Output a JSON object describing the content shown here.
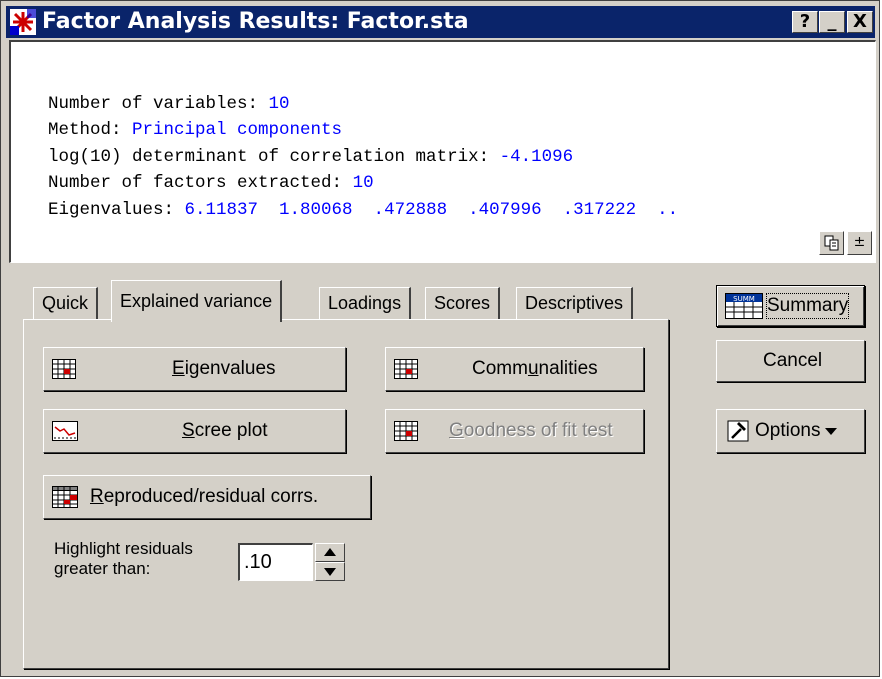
{
  "window": {
    "title": "Factor Analysis Results: Factor.sta",
    "help_btn": "?",
    "minimize_btn": "_",
    "close_btn": "X"
  },
  "output": {
    "lines": [
      {
        "label": "Number of variables: ",
        "value": "10"
      },
      {
        "label": "Method: ",
        "value": "Principal components"
      },
      {
        "label": "log(10) determinant of correlation matrix: ",
        "value": "-4.1096"
      },
      {
        "label": "Number of factors extracted: ",
        "value": "10"
      },
      {
        "label": "Eigenvalues: ",
        "value": "6.11837  1.80068  .472888  .407996  .317222  .."
      }
    ],
    "toggle_btn": "±"
  },
  "tabs": [
    "Quick",
    "Explained variance",
    "Loadings",
    "Scores",
    "Descriptives"
  ],
  "active_tab": "Explained variance",
  "buttons": {
    "eigenvalues": {
      "pre": "",
      "key": "E",
      "post": "igenvalues"
    },
    "communalities": {
      "pre": "Comm",
      "key": "u",
      "post": "nalities"
    },
    "scree_plot": {
      "pre": "",
      "key": "S",
      "post": "cree plot"
    },
    "goodness": {
      "pre": "",
      "key": "G",
      "post": "oodness of fit test"
    },
    "reproduced": {
      "pre": "",
      "key": "R",
      "post": "eproduced/residual corrs."
    }
  },
  "highlight": {
    "label_line1": "Highlight residuals",
    "label_line2": "greater than:",
    "value": ".10"
  },
  "side": {
    "summary": "Summary",
    "summary_icon_text": "SUMM",
    "cancel": "Cancel",
    "options": "Options"
  },
  "colors": {
    "title_bg": "#0a246a",
    "value_text": "#0000ff",
    "face": "#d4d0c8",
    "red_cell": "#cc0000"
  }
}
